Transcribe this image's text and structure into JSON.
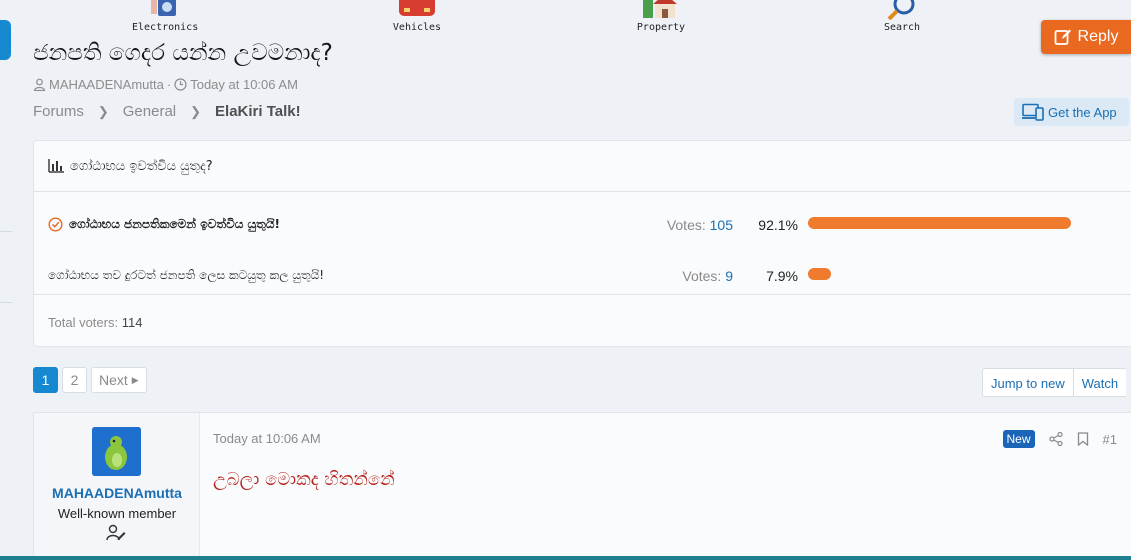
{
  "topnav": {
    "categories": [
      {
        "label": "Electronics",
        "icon": "camera-icon"
      },
      {
        "label": "Vehicles",
        "icon": "car-icon"
      },
      {
        "label": "Property",
        "icon": "house-icon"
      },
      {
        "label": "Search",
        "icon": "search-icon"
      }
    ]
  },
  "thread": {
    "title": "ජනපති ගෙදර යන්න උවමනාද?",
    "author": "MAHAADENAmutta",
    "date": "Today at 10:06 AM",
    "reply_label": "Reply"
  },
  "breadcrumb": [
    "Forums",
    "General",
    "ElaKiri Talk!"
  ],
  "get_app_label": "Get the App",
  "poll": {
    "question": "ගෝඨාභය ඉවත්විය යුතුද?",
    "votes_label": "Votes:",
    "responses": [
      {
        "text": "ගෝඨාභය ජනපතිකමෙන් ඉවත්විය යුතුයි!",
        "votes": "105",
        "percent": "92.1%",
        "fraction": 0.921,
        "voted": true
      },
      {
        "text": "ගෝඨාභය තව දුරටත් ජනපති ලෙස කටයුතු කල යුතුයි!",
        "votes": "9",
        "percent": "7.9%",
        "fraction": 0.079,
        "voted": false
      }
    ],
    "total_label": "Total voters:",
    "total": "114"
  },
  "pager": {
    "pages": [
      "1",
      "2"
    ],
    "current": "1",
    "next_label": "Next"
  },
  "thread_actions": {
    "jump_label": "Jump to new",
    "watch_label": "Watch"
  },
  "post": {
    "username": "MAHAADENAmutta",
    "user_title": "Well-known member",
    "date": "Today at 10:06 AM",
    "body": "උබලා මොකද හිතන්නේ",
    "new_badge": "New",
    "number": "#1"
  },
  "colors": {
    "accent": "#1588d0",
    "reply": "#e8691f",
    "bar": "#f07a2d",
    "link": "#1b6fb3",
    "post_text": "#b5231b"
  }
}
